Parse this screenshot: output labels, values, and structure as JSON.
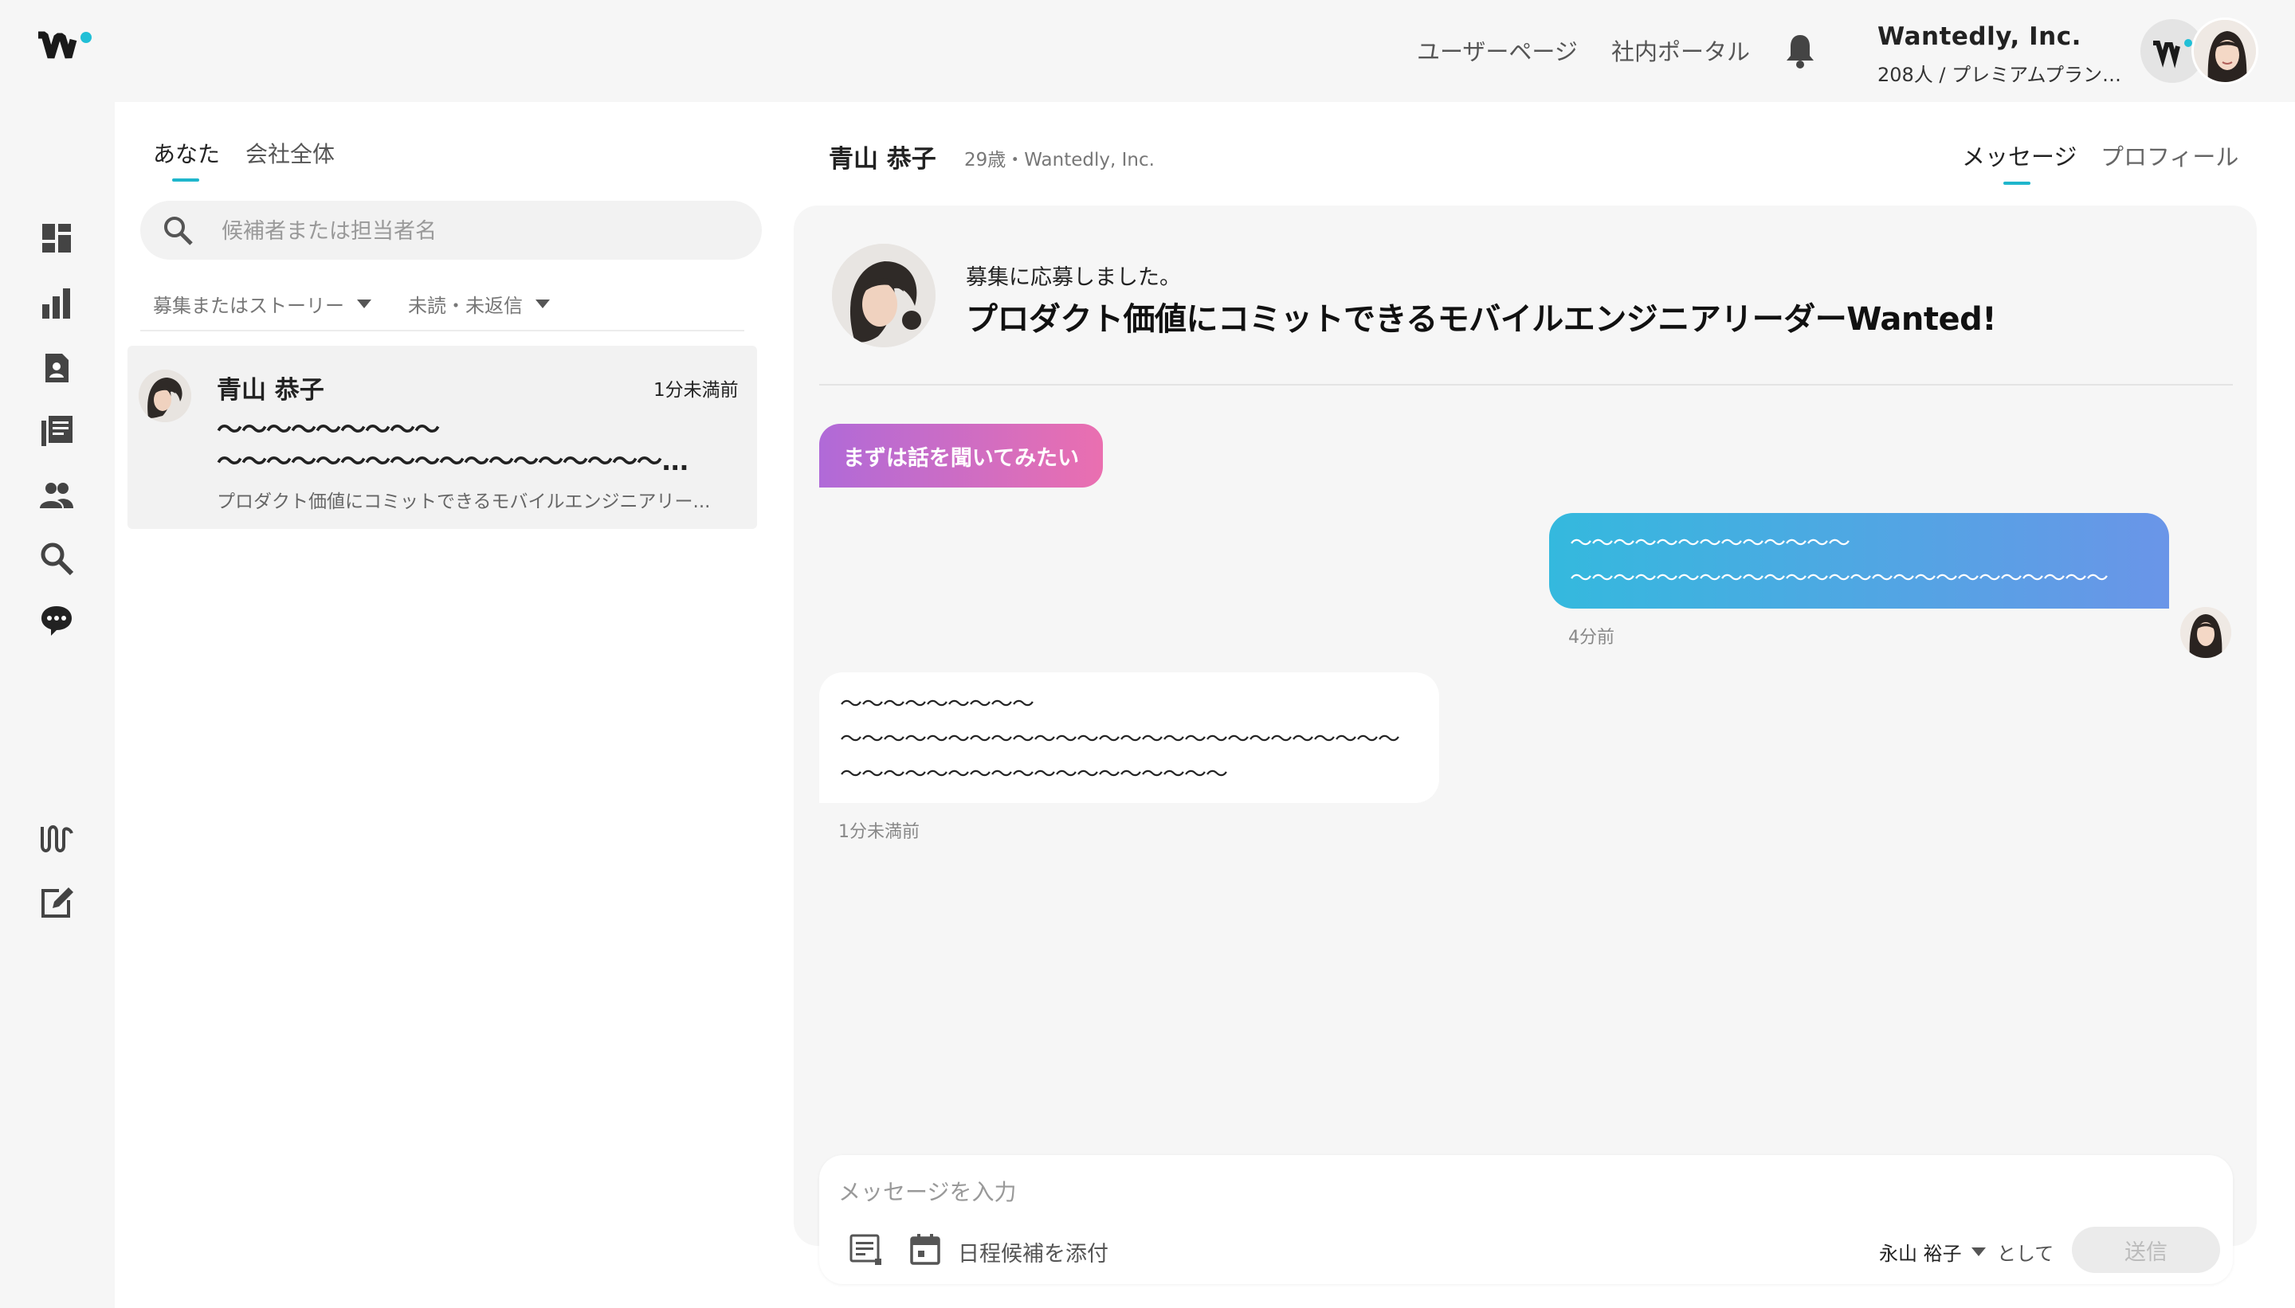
{
  "header": {
    "links": [
      "ユーザーページ",
      "社内ポータル"
    ],
    "company_name": "Wantedly, Inc.",
    "company_plan": "208人 / プレミアムプラン ..."
  },
  "colors": {
    "accent": "#1fb6cc",
    "brand_dot": "#21bfd6",
    "tag_gradient": [
      "#b06ad8",
      "#ea6fb0"
    ],
    "sent_gradient": [
      "#34b9de",
      "#6a95e8"
    ]
  },
  "sidebar": {
    "icons": [
      "dashboard-icon",
      "analytics-icon",
      "candidate-icon",
      "article-icon",
      "people-icon",
      "search-icon",
      "chat-icon",
      "wantedly-logo-icon",
      "compose-icon"
    ],
    "active": "chat-icon"
  },
  "list": {
    "tabs": [
      "あなた",
      "会社全体"
    ],
    "active_tab": "あなた",
    "search_placeholder": "候補者または担当者名",
    "filters": [
      "募集またはストーリー",
      "未読・未返信"
    ],
    "conversations": [
      {
        "name": "青山 恭子",
        "time": "1分未満前",
        "message_lines": [
          "〜〜〜〜〜〜〜〜〜",
          "〜〜〜〜〜〜〜〜〜〜〜〜〜〜〜〜〜〜..."
        ],
        "preview": "プロダクト価値にコミットできるモバイルエンジニアリー..."
      }
    ]
  },
  "detail": {
    "candidate_name": "青山 恭子",
    "candidate_meta": "29歳・Wantedly, Inc.",
    "tabs": [
      "メッセージ",
      "プロフィール"
    ],
    "active_tab": "メッセージ",
    "applied_text": "募集に応募しました。",
    "job_title": "プロダクト価値にコミットできるモバイルエンジニアリーダーWanted!",
    "interest_tag": "まずは話を聞いてみたい",
    "messages": [
      {
        "direction": "sent",
        "lines": [
          "〜〜〜〜〜〜〜〜〜〜〜〜〜",
          "〜〜〜〜〜〜〜〜〜〜〜〜〜〜〜〜〜〜〜〜〜〜〜〜〜"
        ],
        "time": "4分前"
      },
      {
        "direction": "received",
        "lines": [
          "〜〜〜〜〜〜〜〜〜",
          "〜〜〜〜〜〜〜〜〜〜〜〜〜〜〜〜〜〜〜〜〜〜〜〜〜〜",
          "〜〜〜〜〜〜〜〜〜〜〜〜〜〜〜〜〜〜"
        ],
        "time": "1分未満前"
      }
    ],
    "composer": {
      "placeholder": "メッセージを入力",
      "schedule_label": "日程候補を添付",
      "sender": "永山 裕子",
      "as_label": "として",
      "send_label": "送信"
    }
  }
}
